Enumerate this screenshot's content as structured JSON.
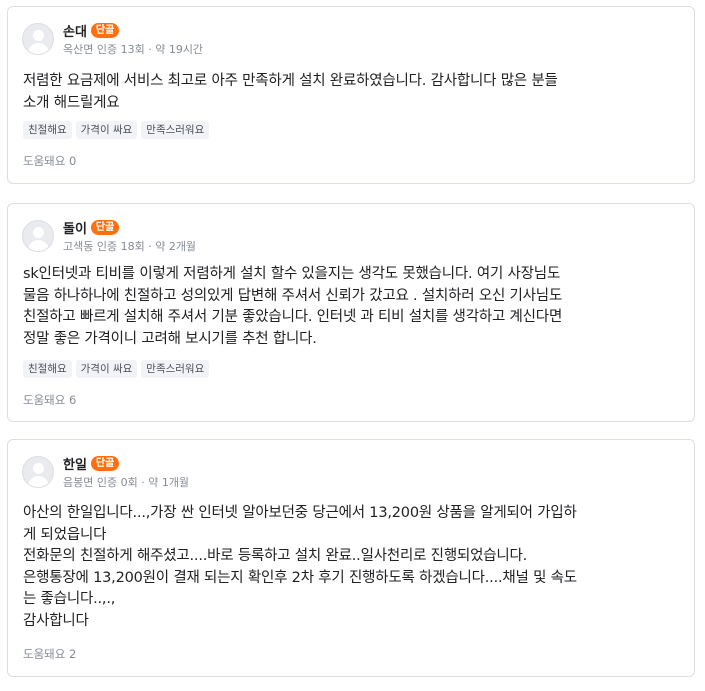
{
  "reviews": [
    {
      "name": "손대",
      "badge": "단골",
      "meta": "옥산면 인증 13회 · 약 19시간",
      "body": [
        "저렴한 요금제에 서비스 최고로 아주 만족하게 설치 완료하였습니다. 감사합니다 많은 분들",
        "소개 해드릴게요"
      ],
      "tags": [
        "친절해요",
        "가격이 싸요",
        "만족스러워요"
      ],
      "helpful": "도움돼요 0"
    },
    {
      "name": "돌이",
      "badge": "단골",
      "meta": "고색동 인증 18회 · 약 2개월",
      "body": [
        "sk인터넷과 티비를 이렇게 저렴하게 설치 할수 있을지는 생각도 못했습니다. 여기 사장님도",
        "물음 하나하나에 친절하고 성의있게 답변해 주셔서 신뢰가 갔고요 . 설치하러 오신 기사님도",
        "친절하고 빠르게 설치해 주셔서 기분 좋았습니다. 인터넷 과 티비 설치를 생각하고 계신다면",
        "정말 좋은 가격이니 고려해 보시기를 추천 합니다."
      ],
      "tags": [
        "친절해요",
        "가격이 싸요",
        "만족스러워요"
      ],
      "helpful": "도움돼요 6"
    },
    {
      "name": "한일",
      "badge": "단골",
      "meta": "음봉면 인증 0회 · 약 1개월",
      "body": [
        "아산의 한일입니다...,가장 싼 인터넷 알아보던중 당근에서 13,200원 상품을 알게되어 가입하",
        "게 되었읍니다",
        "전화문의 친절하게 해주셨고....바로 등록하고 설치 완료..일사천리로 진행되었습니다.",
        "은행통장에 13,200원이 결재 되는지 확인후 2차 후기 진행하도록 하겠습니다....채널 및 속도",
        "는 좋습니다..,.,",
        "감사합니다"
      ],
      "tags": [],
      "helpful": "도움돼요 2"
    }
  ],
  "colors": {
    "badge": "#ff6f0f",
    "tag_bg": "#f2f3f6",
    "muted": "#868b94",
    "border": "#dcdee3"
  },
  "icons": {
    "avatar": "default-profile-icon"
  }
}
